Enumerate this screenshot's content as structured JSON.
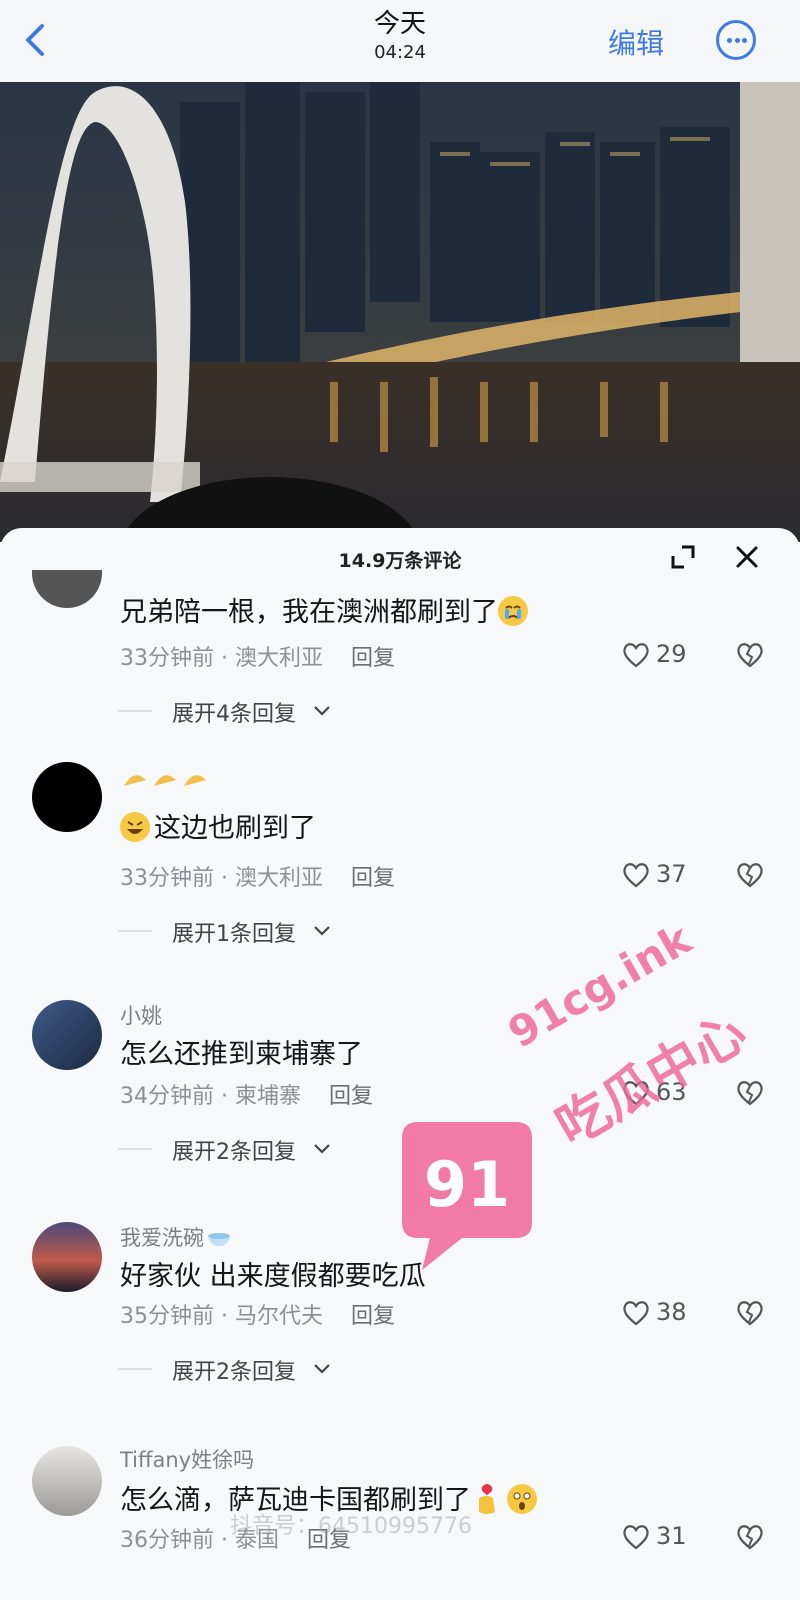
{
  "nav": {
    "title": "今天",
    "time": "04:24",
    "edit_label": "编辑"
  },
  "sheet": {
    "comment_count": "14.9万条评论"
  },
  "comments": [
    {
      "username": "",
      "text": "兄弟陪一根，我在澳洲都刷到了",
      "emoji": "crying-face",
      "time": "33分钟前",
      "location": "澳大利亚",
      "reply": "回复",
      "likes": "29",
      "expand": "展开4条回复"
    },
    {
      "username": "",
      "text": "这边也刷到了",
      "emoji": "rolling-laughing-face",
      "time": "33分钟前",
      "location": "澳大利亚",
      "reply": "回复",
      "likes": "37",
      "expand": "展开1条回复"
    },
    {
      "username": "小姚",
      "text": "怎么还推到柬埔寨了",
      "time": "34分钟前",
      "location": "柬埔寨",
      "reply": "回复",
      "likes": "63",
      "expand": "展开2条回复"
    },
    {
      "username": "我爱洗碗",
      "text": "好家伙 出来度假都要吃瓜",
      "time": "35分钟前",
      "location": "马尔代夫",
      "reply": "回复",
      "likes": "38",
      "expand": "展开2条回复"
    },
    {
      "username": "Tiffany姓徐吗",
      "text": "怎么滴，萨瓦迪卡国都刷到了",
      "time": "36分钟前",
      "location": "泰国",
      "reply": "回复",
      "likes": "31"
    }
  ],
  "watermark": {
    "badge": "91",
    "url": "91cg.ink",
    "name": "吃瓜中心",
    "douyin": "抖音号：64510995776"
  },
  "colors": {
    "accent": "#3c7be6",
    "watermark": "#f06496"
  }
}
